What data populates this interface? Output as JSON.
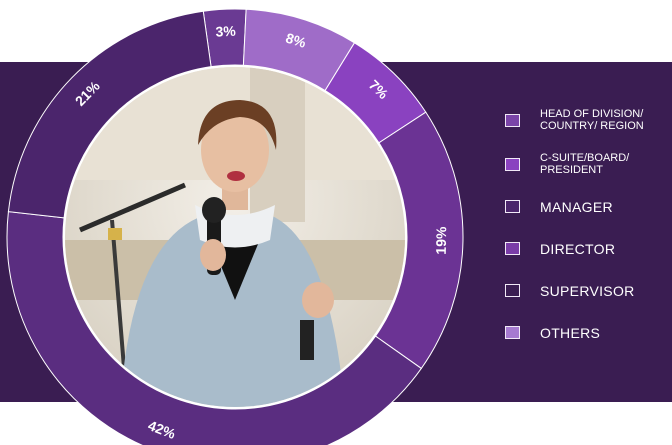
{
  "chart_data": {
    "type": "pie",
    "variant": "donut",
    "title": "",
    "start_angle_deg": -8,
    "direction": "clockwise",
    "slices": [
      {
        "label": "SUPERVISOR",
        "value": 3,
        "data_label": "3%",
        "color": "#6a3a93"
      },
      {
        "label": "OTHERS",
        "value": 8,
        "data_label": "8%",
        "color": "#9f6cc8"
      },
      {
        "label": "C-SUITE/BOARD/PRESIDENT",
        "value": 7,
        "data_label": "7%",
        "color": "#8a42c0"
      },
      {
        "label": "DIRECTOR",
        "value": 19,
        "data_label": "19%",
        "color": "#6b3394"
      },
      {
        "label": "HEAD OF DIVISION/COUNTRY/ REGION",
        "value": 42,
        "data_label": "42%",
        "color": "#5a2d80"
      },
      {
        "label": "MANAGER",
        "value": 21,
        "data_label": "21%",
        "color": "#4b256c"
      }
    ],
    "legend_position": "right",
    "legend": [
      {
        "lines": [
          "HEAD OF DIVISION/",
          "COUNTRY/ REGION"
        ],
        "color": "#7a44a8",
        "size": "small"
      },
      {
        "lines": [
          "C-SUITE/BOARD/",
          "PRESIDENT"
        ],
        "color": "#8a42c0",
        "size": "small"
      },
      {
        "lines": [
          "MANAGER"
        ],
        "color": "#4b256c",
        "size": "big"
      },
      {
        "lines": [
          "DIRECTOR"
        ],
        "color": "#7a3ca8",
        "size": "big"
      },
      {
        "lines": [
          "SUPERVISOR"
        ],
        "color": "#3a1d52",
        "size": "big"
      },
      {
        "lines": [
          "OTHERS"
        ],
        "color": "#a67ad0",
        "size": "big"
      }
    ]
  },
  "colors": {
    "band": "#3a1d52",
    "ring_divider": "#ffffff",
    "label_text": "#ffffff"
  },
  "center_image": "photo-of-speaker-at-microphone"
}
